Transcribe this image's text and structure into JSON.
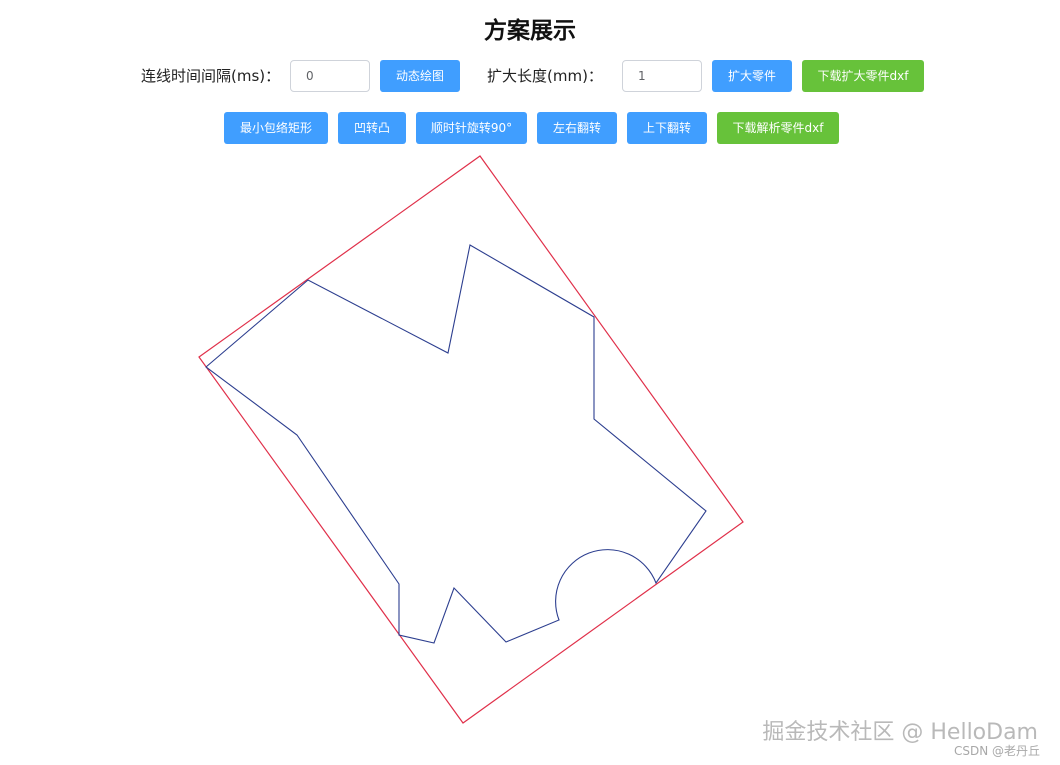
{
  "page": {
    "title": "方案展示"
  },
  "controls": {
    "interval_label": "连线时间间隔(ms)：",
    "interval_value": "0",
    "draw_button": "动态绘图",
    "expand_label": "扩大长度(mm)：",
    "expand_value": "1",
    "expand_button": "扩大零件",
    "download_expanded_button": "下载扩大零件dxf"
  },
  "actions": {
    "min_bbox_button": "最小包络矩形",
    "concave_convex_button": "凹转凸",
    "rotate_button": "顺时针旋转90°",
    "flip_lr_button": "左右翻转",
    "flip_ud_button": "上下翻转",
    "download_parsed_button": "下载解析零件dxf"
  },
  "drawing": {
    "part_color": "#2c3e8f",
    "bbox_color": "#e0304a"
  },
  "watermark": {
    "main": "掘金技术社区 @ HelloDam",
    "sub": "CSDN @老丹丘"
  },
  "colors": {
    "primary": "#409eff",
    "success": "#67c23a"
  }
}
